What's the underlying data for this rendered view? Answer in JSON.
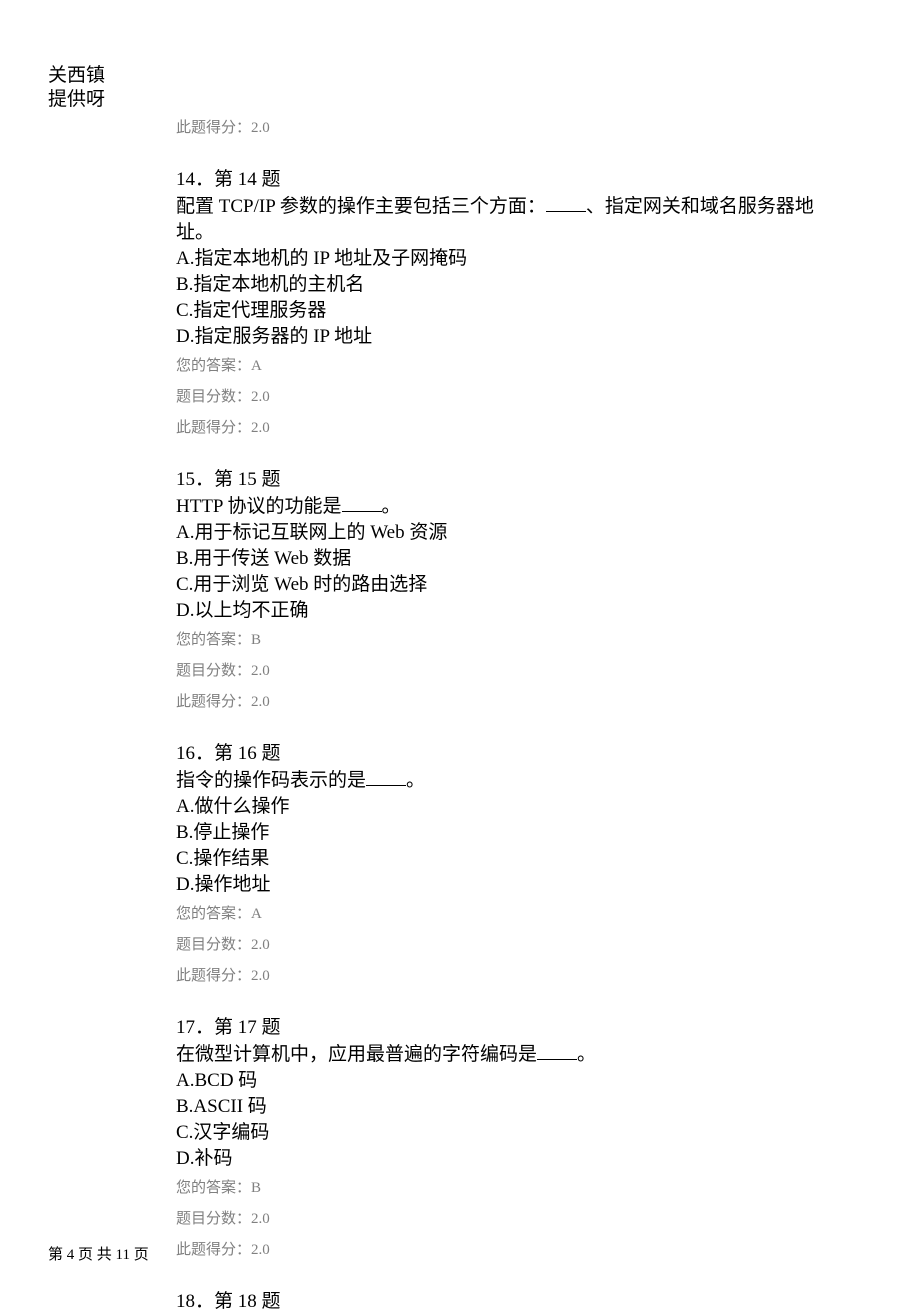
{
  "header": {
    "line1": "关西镇",
    "line2": "提供呀"
  },
  "top_meta": {
    "score_earned": "此题得分：2.0"
  },
  "questions": [
    {
      "title": "14．第 14 题",
      "stem_pre": "配置 TCP/IP 参数的操作主要包括三个方面：",
      "stem_post": "、指定网关和域名服务器地址。",
      "has_blank": true,
      "options": [
        "A.指定本地机的 IP 地址及子网掩码",
        "B.指定本地机的主机名",
        "C.指定代理服务器",
        "D.指定服务器的 IP 地址"
      ],
      "answer": "您的答案：A",
      "full_score": "题目分数：2.0",
      "score_earned": "此题得分：2.0"
    },
    {
      "title": "15．第 15 题",
      "stem_pre": "HTTP 协议的功能是",
      "stem_post": "。",
      "has_blank": true,
      "options": [
        "A.用于标记互联网上的 Web 资源",
        "B.用于传送 Web 数据",
        "C.用于浏览 Web 时的路由选择",
        "D.以上均不正确"
      ],
      "answer": "您的答案：B",
      "full_score": "题目分数：2.0",
      "score_earned": "此题得分：2.0"
    },
    {
      "title": "16．第 16 题",
      "stem_pre": "指令的操作码表示的是",
      "stem_post": "。",
      "has_blank": true,
      "options": [
        "A.做什么操作",
        "B.停止操作",
        "C.操作结果",
        "D.操作地址"
      ],
      "answer": "您的答案：A",
      "full_score": "题目分数：2.0",
      "score_earned": "此题得分：2.0"
    },
    {
      "title": "17．第 17 题",
      "stem_pre": "在微型计算机中，应用最普遍的字符编码是",
      "stem_post": "。",
      "has_blank": true,
      "options": [
        "A.BCD 码",
        "B.ASCII 码",
        "C.汉字编码",
        "D.补码"
      ],
      "answer": "您的答案：B",
      "full_score": "题目分数：2.0",
      "score_earned": "此题得分：2.0"
    },
    {
      "title": "18．第 18 题"
    }
  ],
  "footer": "第 4 页 共 11 页"
}
